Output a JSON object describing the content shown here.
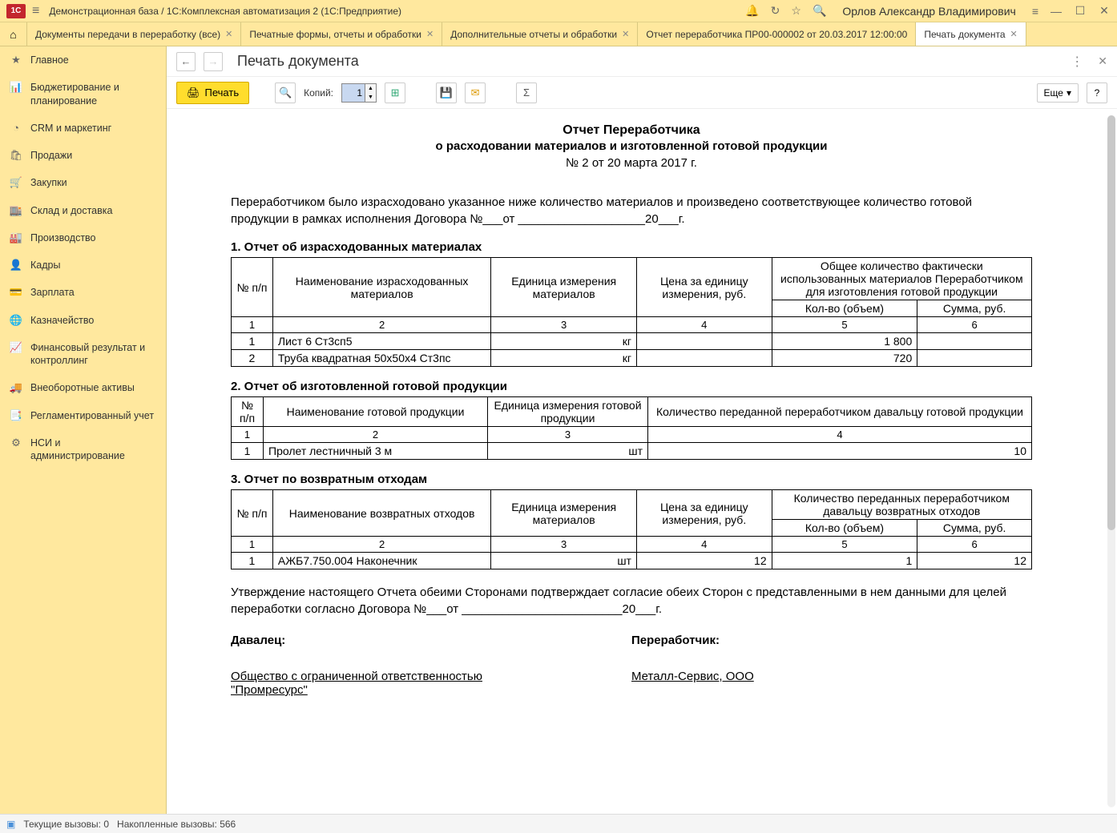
{
  "titlebar": {
    "title": "Демонстрационная база / 1С:Комплексная автоматизация 2  (1С:Предприятие)",
    "user": "Орлов Александр Владимирович"
  },
  "tabs": [
    {
      "label": "Документы передачи в переработку (все)",
      "closable": true
    },
    {
      "label": "Печатные формы, отчеты и обработки",
      "closable": true
    },
    {
      "label": "Дополнительные отчеты и обработки",
      "closable": true
    },
    {
      "label": "Отчет переработчика ПР00-000002 от 20.03.2017 12:00:00",
      "closable": false
    },
    {
      "label": "Печать документа",
      "closable": true,
      "active": true
    }
  ],
  "sidebar": [
    {
      "icon": "★",
      "label": "Главное"
    },
    {
      "icon": "📊",
      "label": "Бюджетирование и планирование"
    },
    {
      "icon": "◔",
      "label": "CRM и маркетинг"
    },
    {
      "icon": "🛍",
      "label": "Продажи"
    },
    {
      "icon": "🛒",
      "label": "Закупки"
    },
    {
      "icon": "🏬",
      "label": "Склад и доставка"
    },
    {
      "icon": "🏭",
      "label": "Производство"
    },
    {
      "icon": "👤",
      "label": "Кадры"
    },
    {
      "icon": "💳",
      "label": "Зарплата"
    },
    {
      "icon": "🌐",
      "label": "Казначейство"
    },
    {
      "icon": "📈",
      "label": "Финансовый результат и контроллинг"
    },
    {
      "icon": "🚚",
      "label": "Внеоборотные активы"
    },
    {
      "icon": "📑",
      "label": "Регламентированный учет"
    },
    {
      "icon": "⚙",
      "label": "НСИ и администрирование"
    }
  ],
  "page": {
    "title": "Печать документа",
    "print_label": "Печать",
    "copies_label": "Копий:",
    "copies_value": "1",
    "more_label": "Еще"
  },
  "doc": {
    "h1": "Отчет Переработчика",
    "h2": "о расходовании материалов и изготовленной готовой продукции",
    "num": "№ 2 от 20 марта 2017 г.",
    "intro": "Переработчиком было израсходовано указанное ниже количество материалов и произведено соответствующее количество готовой продукции в рамках исполнения Договора №___от ___________________20___г.",
    "s1": {
      "title": "1. Отчет об израсходованных материалах",
      "head": [
        "№ п/п",
        "Наименование израсходованных материалов",
        "Единица измерения материалов",
        "Цена за единицу измерения, руб.",
        "Общее количество фактически использованных материалов Переработчиком для изготовления готовой продукции"
      ],
      "sub": [
        "Кол-во (объем)",
        "Сумма, руб."
      ],
      "numrow": [
        "1",
        "2",
        "3",
        "4",
        "5",
        "6"
      ],
      "rows": [
        {
          "n": "1",
          "name": "Лист 6 Ст3сп5",
          "unit": "кг",
          "price": "",
          "qty": "1 800",
          "sum": ""
        },
        {
          "n": "2",
          "name": "Труба квадратная 50х50х4 Ст3пс",
          "unit": "кг",
          "price": "",
          "qty": "720",
          "sum": ""
        }
      ]
    },
    "s2": {
      "title": "2. Отчет об изготовленной  готовой продукции",
      "head": [
        "№ п/п",
        "Наименование готовой продукции",
        "Единица измерения готовой продукции",
        "Количество переданной переработчиком давальцу готовой продукции"
      ],
      "numrow": [
        "1",
        "2",
        "3",
        "4"
      ],
      "rows": [
        {
          "n": "1",
          "name": "Пролет лестничный 3 м",
          "unit": "шт",
          "qty": "10"
        }
      ]
    },
    "s3": {
      "title": "3. Отчет по возвратным отходам",
      "head": [
        "№ п/п",
        "Наименование возвратных отходов",
        "Единица измерения материалов",
        "Цена за единицу измерения, руб.",
        "Количество переданных переработчиком давальцу возвратных отходов"
      ],
      "sub": [
        "Кол-во (объем)",
        "Сумма, руб."
      ],
      "numrow": [
        "1",
        "2",
        "3",
        "4",
        "5",
        "6"
      ],
      "rows": [
        {
          "n": "1",
          "name": "АЖБ7.750.004 Наконечник",
          "unit": "шт",
          "price": "12",
          "qty": "1",
          "sum": "12"
        }
      ]
    },
    "confirm": "Утверждение настоящего Отчета обеими Сторонами подтверждает согласие обеих  Сторон с представленными в нем данными для целей переработки согласно Договора №___от ________________________20___г.",
    "giver_label": "Давалец:",
    "proc_label": "Переработчик:",
    "giver_name1": "Общество с ограниченной ответственностью ",
    "giver_name2": "\"Промресурс\"",
    "proc_name": "Металл-Сервис, ООО"
  },
  "status": {
    "current": "Текущие вызовы: 0",
    "accum": "Накопленные вызовы: 566"
  }
}
